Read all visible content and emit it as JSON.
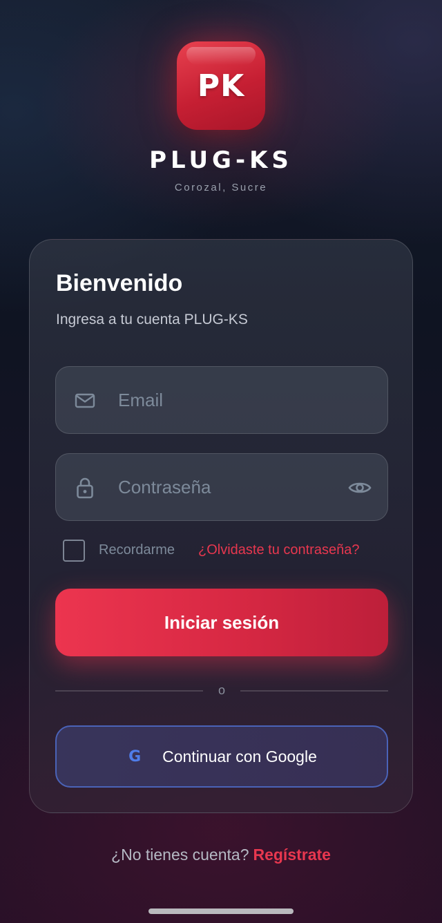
{
  "app": {
    "logo_initials": "PK",
    "brand_name": "PLUG-KS",
    "location": "Corozal, Sucre",
    "accent_color": "#e8374f"
  },
  "login_card": {
    "title": "Bienvenido",
    "subtitle": "Ingresa a tu cuenta PLUG-KS",
    "email_field": {
      "placeholder": "Email",
      "value": "",
      "icon": "mail-icon"
    },
    "password_field": {
      "placeholder": "Contraseña",
      "value": "",
      "icon": "lock-icon",
      "toggle_icon": "eye-icon"
    },
    "remember_label": "Recordarme",
    "remember_checked": false,
    "forgot_link": "¿Olvidaste tu contraseña?",
    "login_button": "Iniciar sesión",
    "divider_text": "o",
    "google_button": {
      "icon": "G",
      "label": "Continuar con Google"
    }
  },
  "footer": {
    "question": "¿No tienes cuenta?",
    "register_link": "Regístrate"
  }
}
